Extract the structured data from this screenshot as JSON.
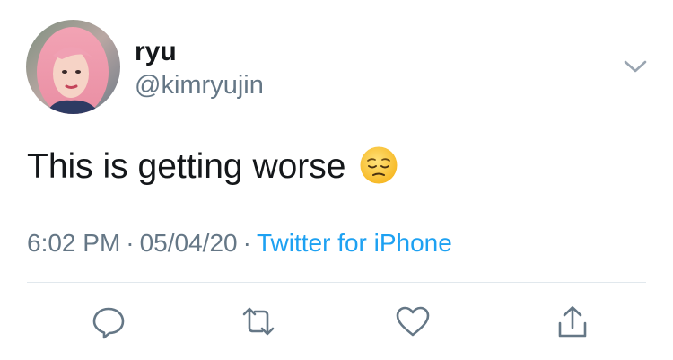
{
  "user": {
    "display_name": "ryu",
    "handle": "@kimryujin"
  },
  "tweet": {
    "text": "This is getting worse",
    "emoji": "pensive-face-emoji"
  },
  "meta": {
    "time": "6:02 PM",
    "separator": "·",
    "date": "05/04/20",
    "source": "Twitter for iPhone"
  },
  "actions": {
    "icons": [
      "reply-icon",
      "retweet-icon",
      "like-icon",
      "share-icon"
    ]
  },
  "colors": {
    "text": "#14171a",
    "secondary": "#657786",
    "link": "#1da1f2",
    "divider": "#e1e8ed"
  }
}
